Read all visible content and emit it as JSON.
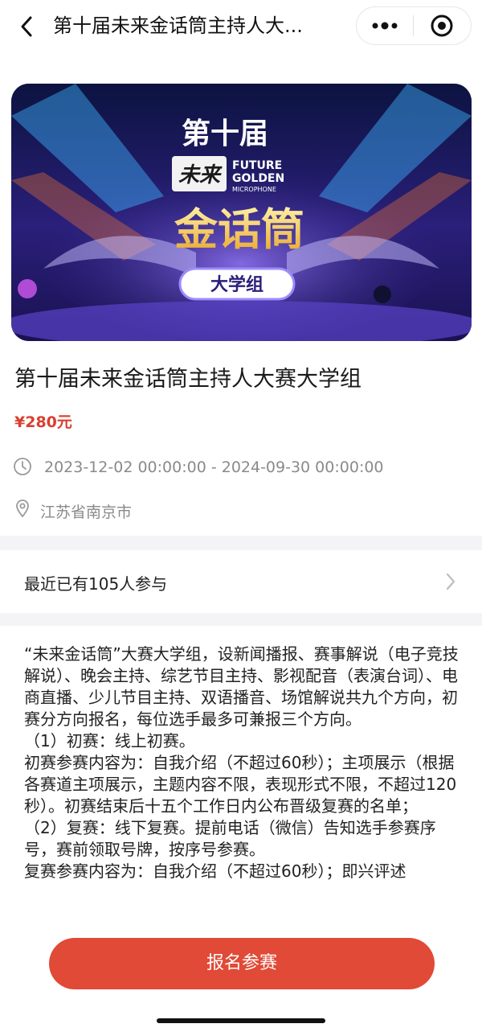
{
  "header": {
    "title": "第十届未来金话筒主持人大...",
    "back_icon": "chevron-left-icon",
    "more_icon": "more-dots-icon",
    "close_icon": "target-close-icon"
  },
  "banner": {
    "line1": "第十届",
    "line2_cn": "未来",
    "line2_en_1": "FUTURE",
    "line2_en_2": "GOLDEN",
    "line2_en_3": "MICROPHONE",
    "line3": "金话筒",
    "badge": "大学组"
  },
  "event": {
    "title": "第十届未来金话筒主持人大赛大学组",
    "price": "¥280元",
    "date_range": "2023-12-02 00:00:00 - 2024-09-30 00:00:00",
    "location": "江苏省南京市"
  },
  "participants": {
    "text": "最近已有105人参与"
  },
  "description": {
    "text": "“未来金话筒”大赛大学组，设新闻播报、赛事解说（电子竞技解说）、晚会主持、综艺节目主持、影视配音（表演台词）、电商直播、少儿节目主持、双语播音、场馆解说共九个方向，初赛分方向报名，每位选手最多可兼报三个方向。\n（1）初赛：线上初赛。\n初赛参赛内容为：自我介绍（不超过60秒）；主项展示（根据各赛道主项展示，主题内容不限，表现形式不限，不超过120秒）。初赛结束后十五个工作日内公布晋级复赛的名单；\n（2）复赛：线下复赛。提前电话（微信）告知选手参赛序号，赛前领取号牌，按序号参赛。\n复赛参赛内容为：自我介绍（不超过60秒）；即兴评述"
  },
  "footer": {
    "signup_label": "报名参赛"
  },
  "colors": {
    "accent": "#e04a36",
    "price": "#d93f2f",
    "muted": "#8a8a8a"
  }
}
